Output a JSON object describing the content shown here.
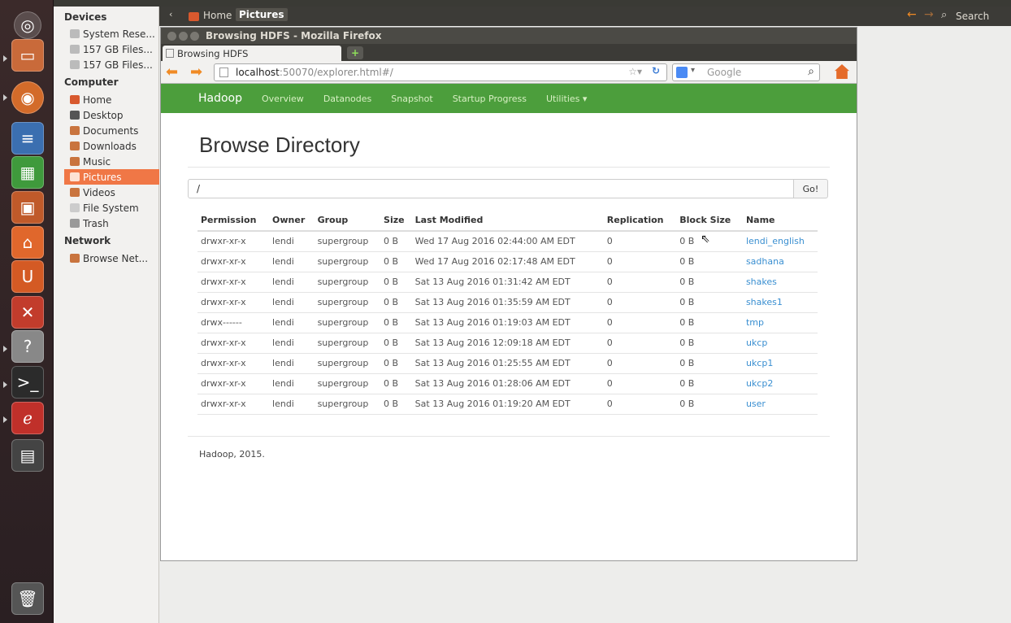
{
  "top_panel": {
    "tabs": [
      "Home",
      "Pictures"
    ],
    "search_label": "Search"
  },
  "sidebar": {
    "devices_header": "Devices",
    "devices": [
      "System Rese...",
      "157 GB Files...",
      "157 GB Files..."
    ],
    "computer_header": "Computer",
    "computer": [
      "Home",
      "Desktop",
      "Documents",
      "Downloads",
      "Music",
      "Pictures",
      "Videos",
      "File System",
      "Trash"
    ],
    "network_header": "Network",
    "network": [
      "Browse Net..."
    ]
  },
  "firefox": {
    "window_title": "Browsing HDFS - Mozilla Firefox",
    "tab_title": "Browsing HDFS",
    "url_host": "localhost",
    "url_path": ":50070/explorer.html#/",
    "search_placeholder": "Google"
  },
  "hadoop": {
    "brand": "Hadoop",
    "nav": [
      "Overview",
      "Datanodes",
      "Snapshot",
      "Startup Progress",
      "Utilities"
    ],
    "page_title": "Browse Directory",
    "path_value": "/",
    "go_label": "Go!",
    "columns": [
      "Permission",
      "Owner",
      "Group",
      "Size",
      "Last Modified",
      "Replication",
      "Block Size",
      "Name"
    ],
    "rows": [
      [
        "drwxr-xr-x",
        "lendi",
        "supergroup",
        "0 B",
        "Wed 17 Aug 2016 02:44:00 AM EDT",
        "0",
        "0 B",
        "lendi_english"
      ],
      [
        "drwxr-xr-x",
        "lendi",
        "supergroup",
        "0 B",
        "Wed 17 Aug 2016 02:17:48 AM EDT",
        "0",
        "0 B",
        "sadhana"
      ],
      [
        "drwxr-xr-x",
        "lendi",
        "supergroup",
        "0 B",
        "Sat 13 Aug 2016 01:31:42 AM EDT",
        "0",
        "0 B",
        "shakes"
      ],
      [
        "drwxr-xr-x",
        "lendi",
        "supergroup",
        "0 B",
        "Sat 13 Aug 2016 01:35:59 AM EDT",
        "0",
        "0 B",
        "shakes1"
      ],
      [
        "drwx------",
        "lendi",
        "supergroup",
        "0 B",
        "Sat 13 Aug 2016 01:19:03 AM EDT",
        "0",
        "0 B",
        "tmp"
      ],
      [
        "drwxr-xr-x",
        "lendi",
        "supergroup",
        "0 B",
        "Sat 13 Aug 2016 12:09:18 AM EDT",
        "0",
        "0 B",
        "ukcp"
      ],
      [
        "drwxr-xr-x",
        "lendi",
        "supergroup",
        "0 B",
        "Sat 13 Aug 2016 01:25:55 AM EDT",
        "0",
        "0 B",
        "ukcp1"
      ],
      [
        "drwxr-xr-x",
        "lendi",
        "supergroup",
        "0 B",
        "Sat 13 Aug 2016 01:28:06 AM EDT",
        "0",
        "0 B",
        "ukcp2"
      ],
      [
        "drwxr-xr-x",
        "lendi",
        "supergroup",
        "0 B",
        "Sat 13 Aug 2016 01:19:20 AM EDT",
        "0",
        "0 B",
        "user"
      ]
    ],
    "footer": "Hadoop, 2015."
  }
}
